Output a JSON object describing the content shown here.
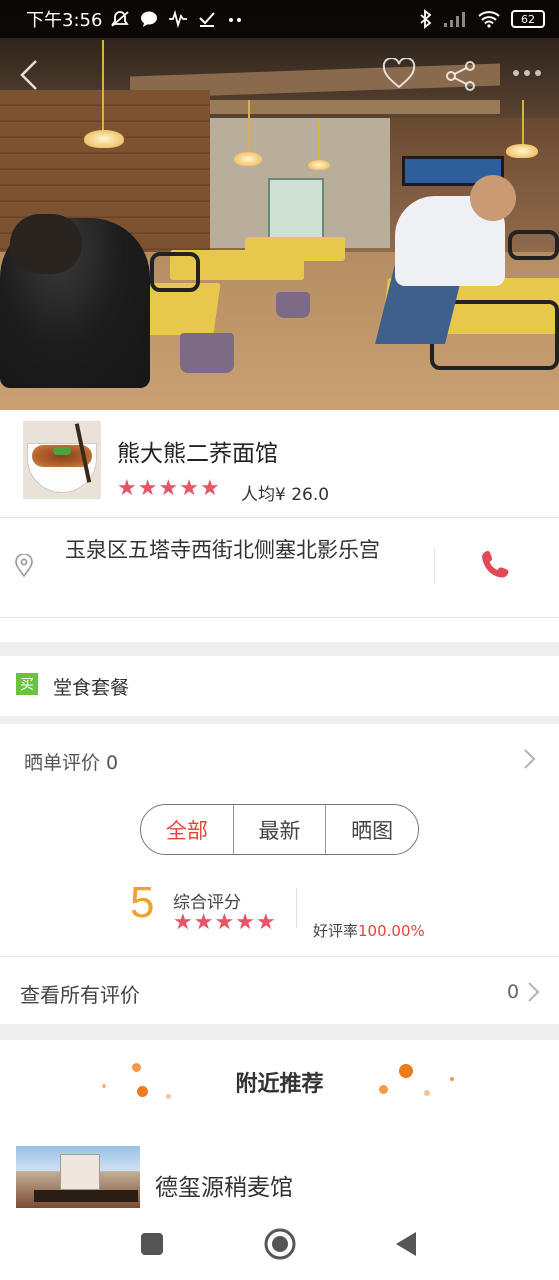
{
  "status_bar": {
    "time": "下午3:56",
    "battery": "62",
    "left_icons": [
      "mute-icon",
      "chat-icon",
      "pulse-icon",
      "check-icon",
      "more-dots-icon"
    ],
    "right_icons": [
      "bluetooth-icon",
      "signal-icon",
      "wifi-icon",
      "battery-icon"
    ]
  },
  "hero": {
    "actions": [
      "back-icon",
      "favorite-heart-icon",
      "share-icon",
      "more-icon"
    ]
  },
  "shop": {
    "name": "熊大熊二荞面馆",
    "rating_stars": 5,
    "avg_price": "人均¥ 26.0",
    "address": "玉泉区五塔寺西街北侧塞北影乐宫",
    "accent_color": "#e55467"
  },
  "combo": {
    "badge": "买",
    "label": "堂食套餐"
  },
  "reviews": {
    "title": "晒单评价 0",
    "tabs": [
      {
        "label": "全部",
        "active": true
      },
      {
        "label": "最新",
        "active": false
      },
      {
        "label": "晒图",
        "active": false
      }
    ],
    "score": "5",
    "score_label": "综合评分",
    "score_stars": 5,
    "good_rate_label": "好评率",
    "good_rate_value": "100.00%",
    "all_label": "查看所有评价",
    "all_count": "0"
  },
  "nearby": {
    "title": "附近推荐",
    "items": [
      {
        "name": "德玺源稍麦馆"
      }
    ]
  },
  "nav": {
    "buttons": [
      "recent-apps-icon",
      "home-icon",
      "back-icon"
    ]
  }
}
